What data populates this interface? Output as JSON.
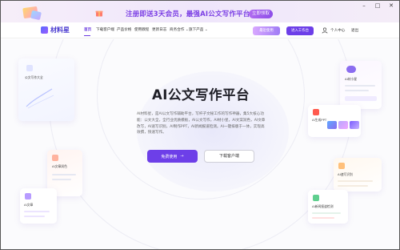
{
  "banner": {
    "text": "注册即送3天会员，最强AI公文写作平台",
    "button": "立即领取"
  },
  "nav": {
    "logo_text": "材料星",
    "items": [
      {
        "label": "首页",
        "active": true
      },
      {
        "label": "下载客户端",
        "active": false
      },
      {
        "label": "产品价格",
        "active": false
      },
      {
        "label": "使用教程",
        "active": false
      },
      {
        "label": "更新日志",
        "active": false
      },
      {
        "label": "商务合作 ⌄",
        "active": false
      },
      {
        "label": "旗下产品 ⌄",
        "active": false
      }
    ],
    "workspace_button": "最近使用",
    "enter_button": "进入工作台",
    "user_center": "个人中心",
    "logout": "退出"
  },
  "hero": {
    "title": "AI公文写作平台",
    "description": "AI材料星，是AI公文写作辅助平台，写杆子文秘工作的写作神器，集5大核心功能：公文大全，全行业优质模板，AI公文写作，AI材小星，AI文案润色，AI文章改写，AI速写识别，AI制作PPT，AI新闻报道检测。AI一键排版于一体，实现高效撰，快速写作。",
    "cta_primary": "免费使用",
    "cta_secondary": "下载客户端"
  },
  "cards": {
    "c1": "公文写作大全",
    "c2": "AI文章润色",
    "c3": "AI文章",
    "c4": "AI材小星",
    "c5": "AI生成PPT",
    "c6": "AI速写识别",
    "c7": "AI新闻报道检测"
  },
  "colors": {
    "accent": "#6d3fe8",
    "banner_text": "#7b3fe4"
  }
}
